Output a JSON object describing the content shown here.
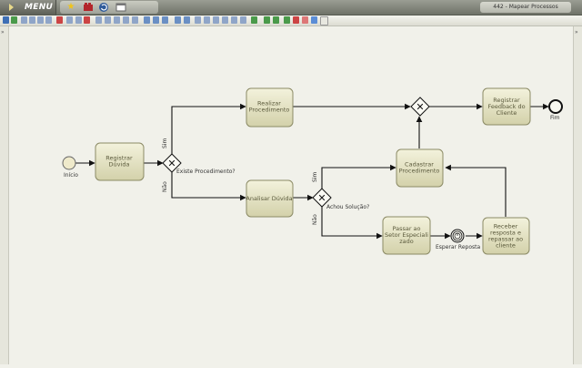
{
  "app": {
    "menu_label": "MENU",
    "window_title": "442 - Mapear Processos",
    "quick_icons": [
      "star-icon",
      "film-icon",
      "refresh-icon",
      "window-icon"
    ],
    "panel_toggle": "»"
  },
  "process": {
    "start": "Início",
    "end": "Fim",
    "tasks": {
      "registrar_duvida": "Registrar|Dúvida",
      "realizar_procedimento": "Realizar|Procedimento",
      "analisar_duvida": "Analisar Dúvida",
      "cadastrar_procedimento": "Cadastrar|Procedimento",
      "registrar_feedback": "Registrar|Feedback do|Cliente",
      "passar_setor": "Passar ao|Setor Especiali|zado",
      "receber_resposta": "Receber|resposta e|repassar ao|cliente"
    },
    "gateways": {
      "existe_procedimento": "Existe Procedimento?",
      "achou_solucao": "Achou Solução?"
    },
    "flow_labels": {
      "sim": "Sim",
      "nao": "Não"
    },
    "timer_event": "Esperar Reposta"
  }
}
